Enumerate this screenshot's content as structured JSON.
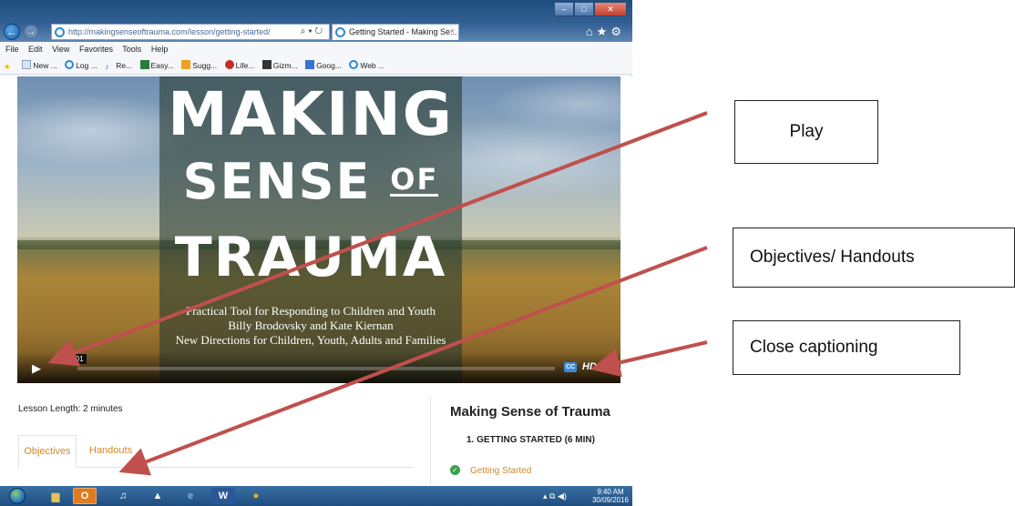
{
  "browser": {
    "url": "http://makingsenseoftrauma.com/lesson/getting-started/",
    "tab_title": "Getting Started - Making Se...",
    "tab_close": "×",
    "menu": [
      "File",
      "Edit",
      "View",
      "Favorites",
      "Tools",
      "Help"
    ],
    "favorites": [
      "New ...",
      "Log ...",
      "Re...",
      "Easy...",
      "Sugg...",
      "Life...",
      "Gizm...",
      "Goog...",
      "Web ..."
    ]
  },
  "video": {
    "title_line1": "MAKING",
    "title_line2_a": "SENSE",
    "title_line2_b": "OF",
    "title_line3": "TRAUMA",
    "subtitle1": "Practical Tool for Responding to Children and Youth",
    "subtitle2": "Billy Brodovsky and Kate Kiernan",
    "subtitle3": "New Directions for Children, Youth, Adults and Families",
    "time": "0:01",
    "cc_label": "CC",
    "hd_label": "HD",
    "colors": {
      "cc_button": "#3a8bd6"
    }
  },
  "page": {
    "lesson_length": "Lesson Length: 2 minutes",
    "tabs": [
      "Objectives",
      "Handouts"
    ],
    "course_title": "Making Sense of Trauma",
    "section": "1.  GETTING STARTED (6 MIN)",
    "lesson_item": "Getting Started",
    "colors": {
      "accent": "#d4892c",
      "complete": "#3aa34a"
    }
  },
  "annotations": {
    "play": "Play",
    "objectives": "Objectives/ Handouts",
    "captioning": "Close captioning",
    "arrow_color": "#c0504d"
  },
  "taskbar": {
    "time": "9:40 AM",
    "date": "30/09/2016"
  }
}
